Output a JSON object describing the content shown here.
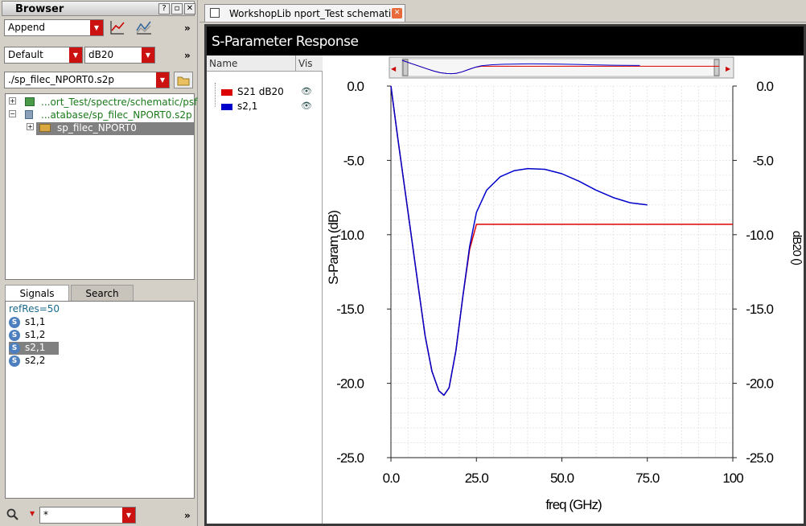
{
  "browser": {
    "title": "Browser",
    "mode": "Append",
    "mode_chevron": "»",
    "preset": "Default",
    "format": "dB20",
    "format_chevron": "»",
    "path": "./sp_filec_NPORT0.s2p",
    "tree": [
      {
        "label": "...ort_Test/spectre/schematic/psf",
        "color": "#1a7a1a"
      },
      {
        "label": "...atabase/sp_filec_NPORT0.s2p",
        "color": "#1a7a1a"
      },
      {
        "label": "sp_filec_NPORT0",
        "color": "#ffffff"
      }
    ],
    "tabs": [
      "Signals",
      "Search"
    ],
    "ref_res": "refRes=50",
    "signals": [
      "s1,1",
      "s1,2",
      "s2,1",
      "s2,2"
    ],
    "filter": "*",
    "filter_chevron": "»"
  },
  "window": {
    "tab_label": "WorkshopLib nport_Test schematic"
  },
  "legend": {
    "name_header": "Name",
    "vis_header": "Vis",
    "entries": [
      {
        "label": "S21 dB20",
        "color": "#dd0000"
      },
      {
        "label": "s2,1",
        "color": "#0000cc"
      }
    ]
  },
  "chart_data": {
    "type": "line",
    "title": "S-Parameter Response",
    "xlabel": "freq (GHz)",
    "ylabel": "S-Param (dB)",
    "ylabel_right": "dB20 ()",
    "xlim": [
      0,
      100
    ],
    "ylim": [
      -25,
      0
    ],
    "xticks": [
      "0.0",
      "25.0",
      "50.0",
      "75.0",
      "100"
    ],
    "yticks": [
      "0.0",
      "-5.0",
      "-10.0",
      "-15.0",
      "-20.0",
      "-25.0"
    ],
    "grid": true,
    "series": [
      {
        "name": "S21 dB20",
        "color": "#dd0000",
        "x": [
          0,
          2,
          5,
          8,
          10,
          12,
          14,
          15.5,
          17,
          19,
          21,
          23,
          25,
          100
        ],
        "y": [
          0,
          -3.5,
          -8.5,
          -13.5,
          -16.8,
          -19.2,
          -20.5,
          -20.8,
          -20.3,
          -17.8,
          -14.2,
          -11.0,
          -9.3,
          -9.3
        ]
      },
      {
        "name": "s2,1",
        "color": "#0000cc",
        "x": [
          0,
          2,
          5,
          8,
          10,
          12,
          14,
          15.5,
          17,
          19,
          21,
          23,
          25,
          28,
          32,
          36,
          40,
          45,
          50,
          55,
          60,
          65,
          70,
          75
        ],
        "y": [
          0,
          -3.5,
          -8.5,
          -13.5,
          -16.8,
          -19.2,
          -20.5,
          -20.8,
          -20.3,
          -17.8,
          -14.2,
          -10.8,
          -8.5,
          -7.0,
          -6.1,
          -5.7,
          -5.55,
          -5.6,
          -5.9,
          -6.4,
          -7.0,
          -7.5,
          -7.85,
          -8.0
        ]
      }
    ]
  }
}
